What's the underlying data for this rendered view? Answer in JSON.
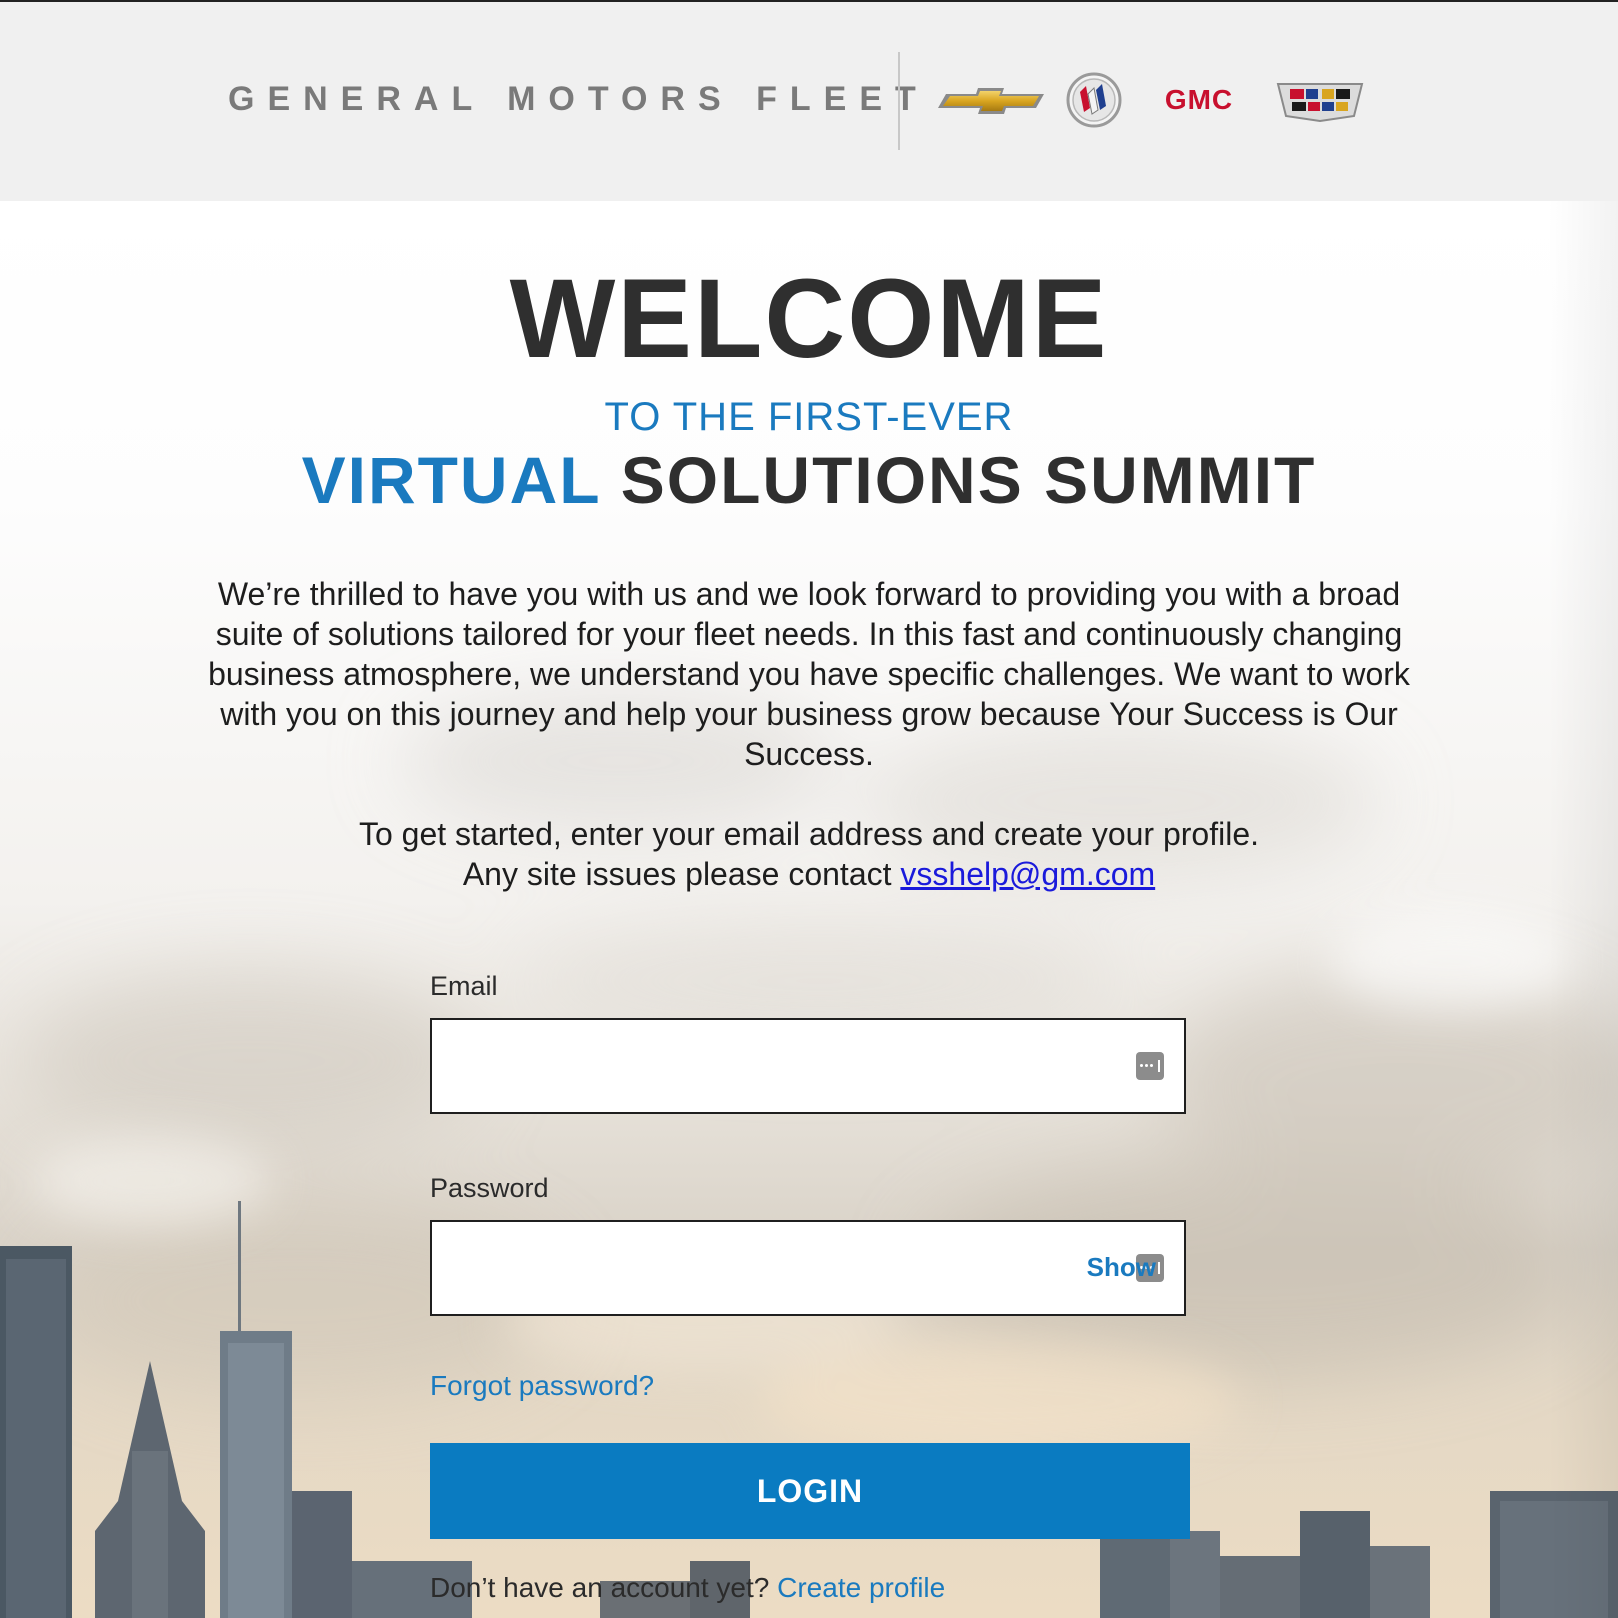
{
  "header": {
    "brand_text": "GENERAL MOTORS FLEET",
    "logos": [
      "chevrolet-logo",
      "buick-logo",
      "gmc-logo",
      "cadillac-logo"
    ],
    "gmc_text": "GMC"
  },
  "hero": {
    "welcome": "WELCOME",
    "subtitle": "TO THE FIRST-EVER",
    "summit_accent": "VIRTUAL",
    "summit_rest": "SOLUTIONS SUMMIT",
    "intro": "We’re thrilled to have you with us and we look forward to providing you with a broad suite of solutions tailored for your fleet needs. In this fast and continuously changing business atmosphere, we understand you have specific challenges. We want to work with you on this journey and help your business grow because Your Success is Our Success.",
    "get_started_line1": "To get started, enter your email address and create your profile.",
    "get_started_line2": "Any site issues please contact",
    "help_email": "vsshelp@gm.com"
  },
  "form": {
    "email_label": "Email",
    "email_value": "",
    "password_label": "Password",
    "password_value": "",
    "show_label": "Show",
    "forgot_label": "Forgot password?",
    "login_label": "LOGIN",
    "signup_prompt": "Don’t have an account yet?",
    "signup_link": "Create profile"
  },
  "colors": {
    "accent": "#1a7abf",
    "button": "#0a7bc1",
    "heading": "#2f2f2f",
    "header_bg": "#f0f0f0",
    "gmc_red": "#c8102e"
  }
}
